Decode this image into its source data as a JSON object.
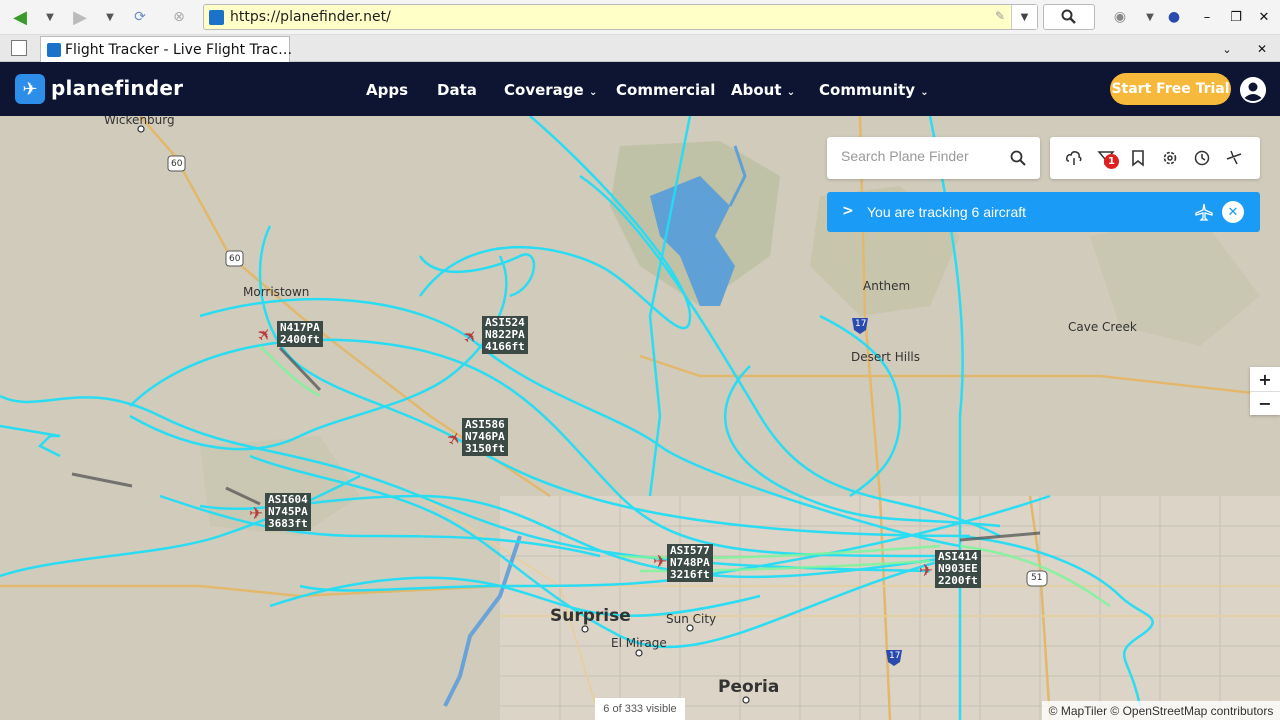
{
  "browser": {
    "url": "https://planefinder.net/",
    "tab_title": "Flight Tracker - Live Flight Trac…"
  },
  "header": {
    "logo": "planefinder",
    "nav": [
      "Apps",
      "Data",
      "Coverage",
      "Commercial",
      "About",
      "Community"
    ],
    "trial_button": "Start Free Trial",
    "colors": {
      "background": "#0d1533",
      "trial": "#f6b93b"
    }
  },
  "search": {
    "placeholder": "Search Plane Finder"
  },
  "toolbar": {
    "alert_count": "1"
  },
  "tracking": {
    "text": "You are tracking 6 aircraft"
  },
  "zoom": {
    "in": "+",
    "out": "−"
  },
  "map": {
    "places": {
      "wickenburg": "Wickenburg",
      "morristown": "Morristown",
      "anthem": "Anthem",
      "cave_creek": "Cave Creek",
      "desert_hills": "Desert Hills",
      "surprise": "Surprise",
      "sun_city": "Sun City",
      "el_mirage": "El Mirage",
      "peoria": "Peoria"
    },
    "highways": {
      "us60a": "60",
      "us60b": "60",
      "i17a": "17",
      "i17b": "17",
      "sr51": "51"
    }
  },
  "aircraft": [
    {
      "callsign": "N417PA",
      "reg": "",
      "altitude": "2400ft"
    },
    {
      "callsign": "ASI524",
      "reg": "N822PA",
      "altitude": "4166ft"
    },
    {
      "callsign": "ASI586",
      "reg": "N746PA",
      "altitude": "3150ft"
    },
    {
      "callsign": "ASI604",
      "reg": "N745PA",
      "altitude": "3683ft"
    },
    {
      "callsign": "ASI577",
      "reg": "N748PA",
      "altitude": "3216ft"
    },
    {
      "callsign": "ASI414",
      "reg": "N903EE",
      "altitude": "2200ft"
    }
  ],
  "footer": {
    "visible_count": "6 of 333 visible",
    "attribution": "© MapTiler © OpenStreetMap contributors"
  }
}
